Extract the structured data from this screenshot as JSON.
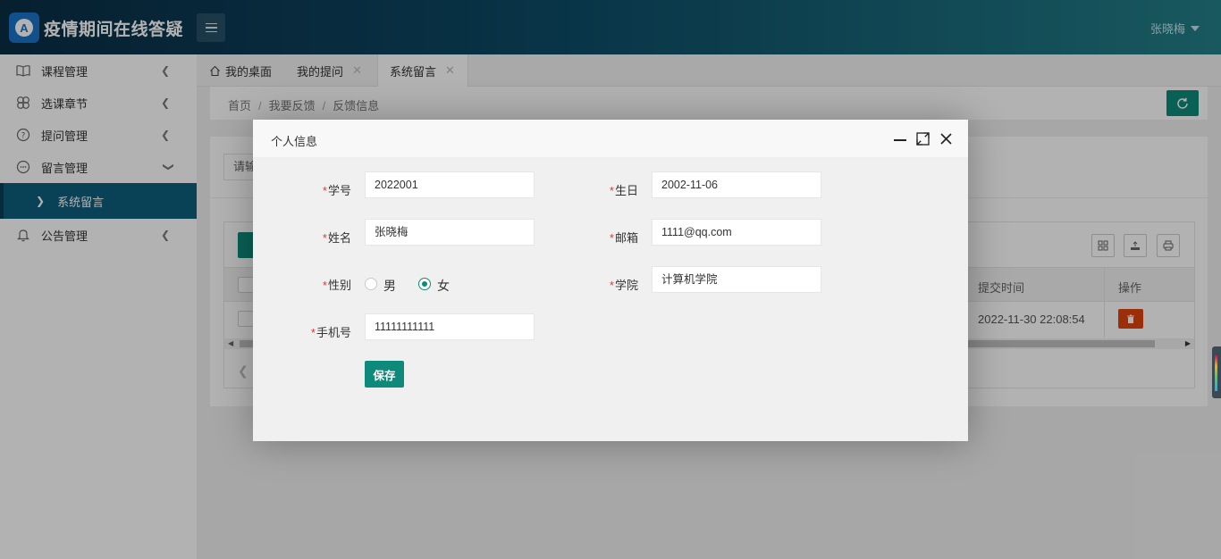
{
  "app": {
    "title": "疫情期间在线答疑",
    "logo_letter": "A",
    "user": "张晓梅"
  },
  "sidebar": {
    "items": [
      {
        "label": "课程管理",
        "icon": "book-icon"
      },
      {
        "label": "选课章节",
        "icon": "clover-icon"
      },
      {
        "label": "提问管理",
        "icon": "question-circle-icon"
      },
      {
        "label": "留言管理",
        "icon": "message-circle-icon"
      },
      {
        "label": "公告管理",
        "icon": "bell-icon"
      }
    ],
    "active_sub": "系统留言"
  },
  "tabs": [
    {
      "label": "我的桌面",
      "icon": "home-icon"
    },
    {
      "label": "我的提问"
    },
    {
      "label": "系统留言",
      "active": true
    }
  ],
  "breadcrumb": [
    "首页",
    "我要反馈",
    "反馈信息"
  ],
  "search": {
    "placeholder": "请输"
  },
  "table": {
    "headers": {
      "time": "提交时间",
      "ops": "操作"
    },
    "rows": [
      {
        "time": "2022-11-30 22:08:54"
      }
    ]
  },
  "modal": {
    "title": "个人信息",
    "fields": {
      "student_id": {
        "label": "学号",
        "value": "2022001"
      },
      "birthday": {
        "label": "生日",
        "value": "2002-11-06"
      },
      "name": {
        "label": "姓名",
        "value": "张晓梅"
      },
      "email": {
        "label": "邮箱",
        "value": "1111@qq.com"
      },
      "gender": {
        "label": "性别",
        "options": [
          "男",
          "女"
        ],
        "selected": "女"
      },
      "college": {
        "label": "学院",
        "value": "计算机学院"
      },
      "phone": {
        "label": "手机号",
        "value": "11111111111"
      }
    },
    "required_mark": "*",
    "save_label": "保存"
  },
  "colors": {
    "accent": "#0e8a7a",
    "sidebar_active": "#0e5d7d",
    "danger": "#e0440e"
  }
}
